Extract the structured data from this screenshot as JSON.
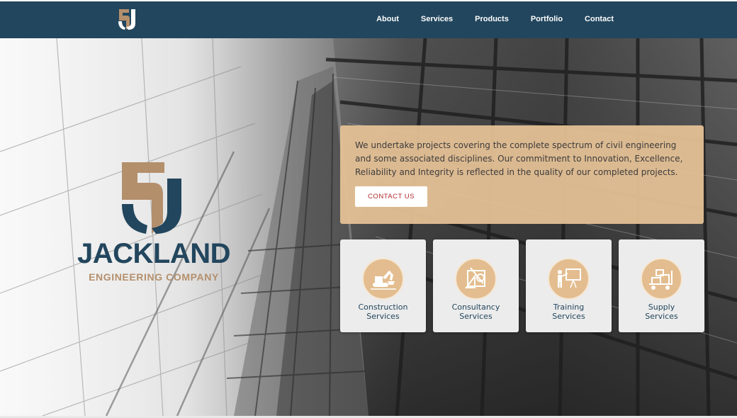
{
  "nav": {
    "logo_icon": "jackland-5j-logo-icon",
    "items": [
      {
        "label": "About"
      },
      {
        "label": "Services"
      },
      {
        "label": "Products"
      },
      {
        "label": "Portfolio"
      },
      {
        "label": "Contact"
      }
    ]
  },
  "brand": {
    "name": "JACKLAND",
    "subtitle": "ENGINEERING COMPANY",
    "mark_icon": "jackland-5j-logo-icon"
  },
  "intro": {
    "text": "We undertake projects covering the complete spectrum of civil engineering and some associated disciplines. Our commitment to Innovation, Excellence, Reliability and Integrity is reflected in the quality of our completed projects.",
    "button_label": "CONTACT US"
  },
  "services": [
    {
      "line1": "Construction",
      "line2": "Services",
      "icon": "excavator-icon"
    },
    {
      "line1": "Consultancy",
      "line2": "Services",
      "icon": "drafting-tools-icon"
    },
    {
      "line1": "Training",
      "line2": "Services",
      "icon": "presentation-board-icon"
    },
    {
      "line1": "Supply",
      "line2": "Services",
      "icon": "hand-truck-boxes-icon"
    }
  ],
  "colors": {
    "navy": "#22465d",
    "tan": "#b48f6c",
    "panel": "#e5c196",
    "icon_circle": "#e3bd8f",
    "button_text": "#b22b2b"
  }
}
